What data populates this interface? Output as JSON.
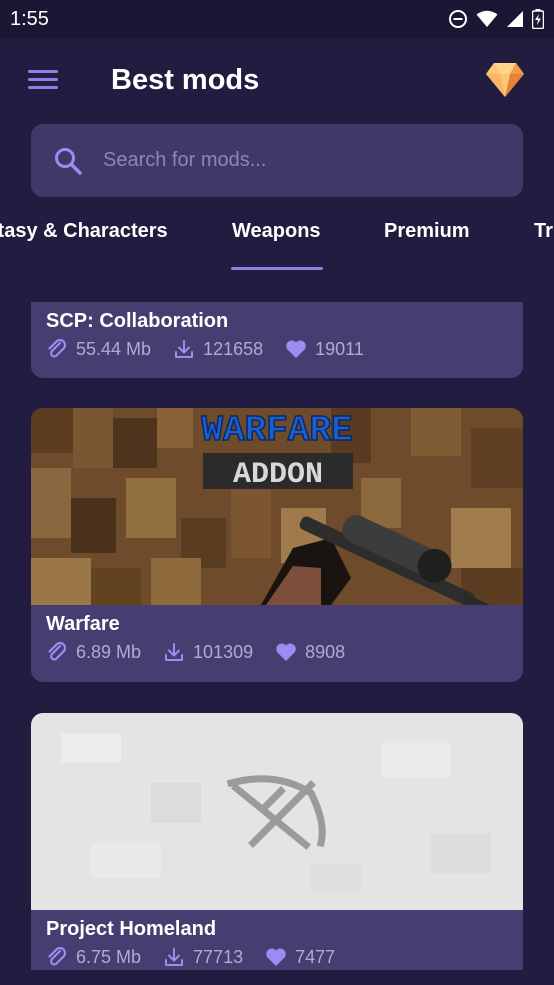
{
  "status_bar": {
    "time": "1:55"
  },
  "header": {
    "title": "Best mods"
  },
  "search": {
    "placeholder": "Search for mods..."
  },
  "tabs": [
    {
      "label": "Fantasy & Characters"
    },
    {
      "label": "Weapons",
      "selected": true
    },
    {
      "label": "Premium"
    },
    {
      "label": "Tr"
    }
  ],
  "mods": [
    {
      "name": "SCP: Collaboration",
      "size": "55.44 Mb",
      "downloads": "121658",
      "likes": "19011"
    },
    {
      "name": "Warfare",
      "size": "6.89 Mb",
      "downloads": "101309",
      "likes": "8908",
      "banner_title": "WARFARE",
      "banner_subtitle": "ADDON"
    },
    {
      "name": "Project Homeland",
      "size": "6.75 Mb",
      "downloads": "77713",
      "likes": "7477"
    }
  ],
  "colors": {
    "background": "#221c40",
    "card": "#463e70",
    "accent": "#8f80e6",
    "stat_text": "#b1aad1"
  },
  "icons": [
    "menu-icon",
    "diamond-icon",
    "search-icon",
    "paperclip-icon",
    "download-icon",
    "heart-icon"
  ]
}
